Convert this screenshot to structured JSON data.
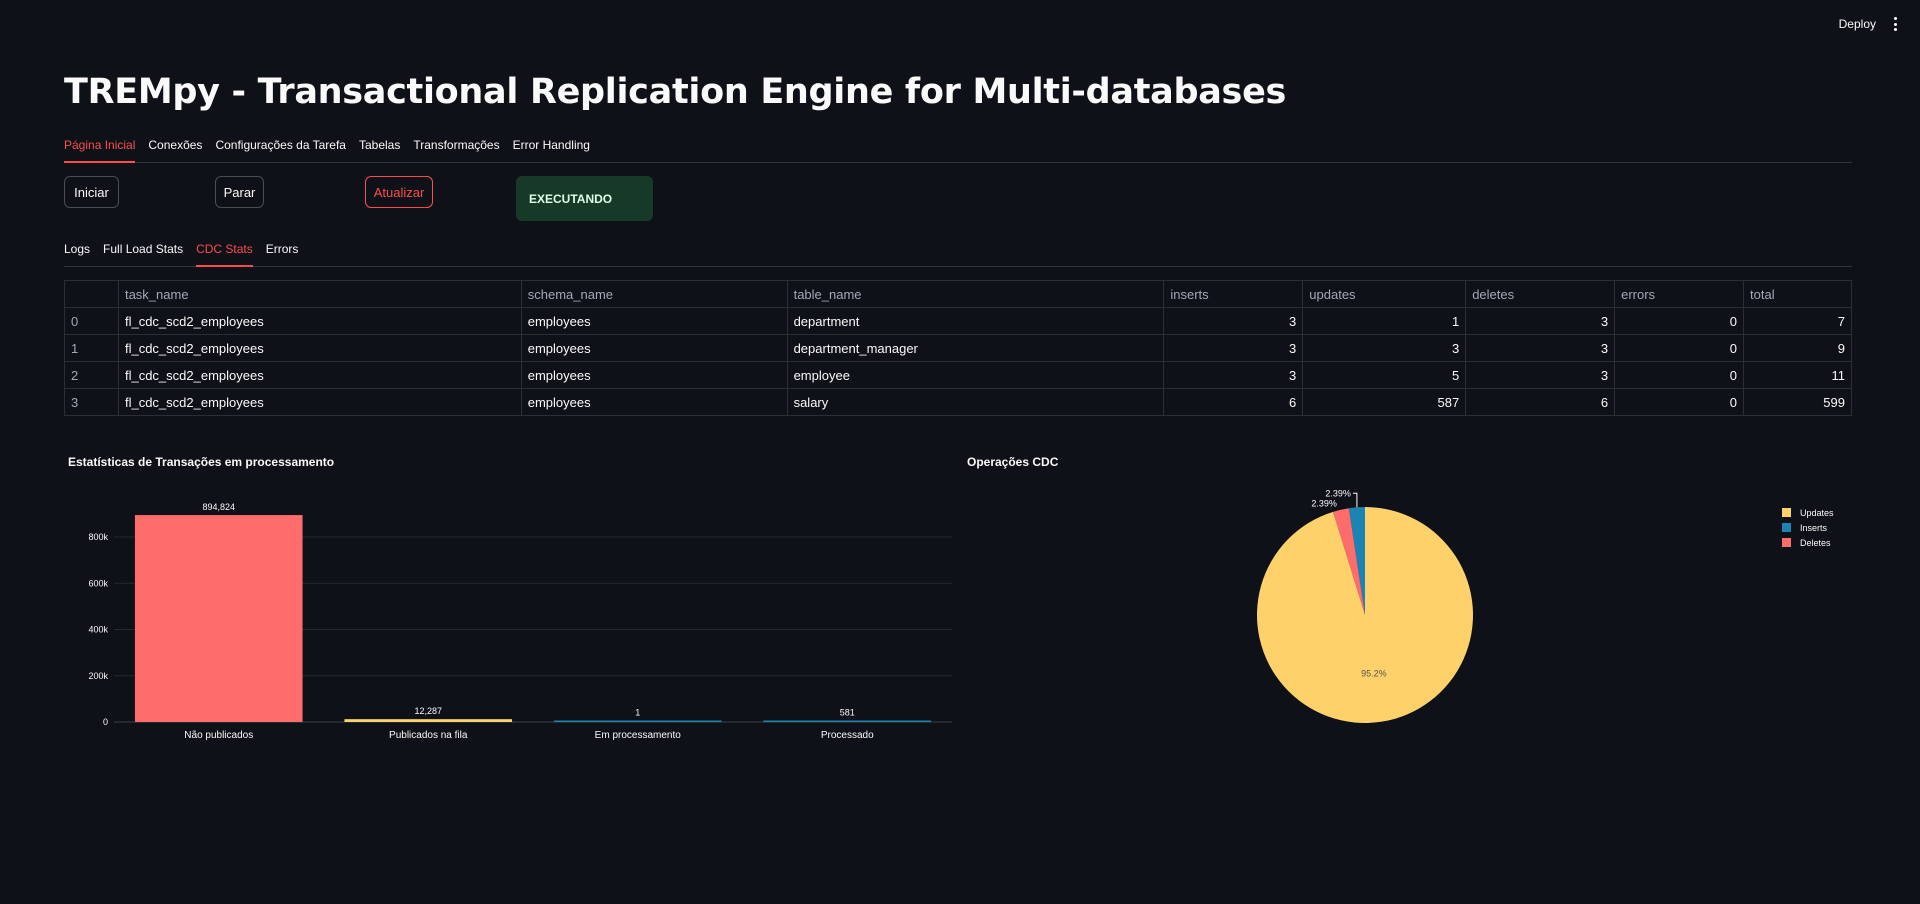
{
  "topbar": {
    "deploy_label": "Deploy"
  },
  "title": "TREMpy - Transactional Replication Engine for Multi-databases",
  "main_tabs": [
    "Página Inicial",
    "Conexões",
    "Configurações da Tarefa",
    "Tabelas",
    "Transformações",
    "Error Handling"
  ],
  "buttons": {
    "start": "Iniciar",
    "stop": "Parar",
    "refresh": "Atualizar"
  },
  "status": "EXECUTANDO",
  "sub_tabs": [
    "Logs",
    "Full Load Stats",
    "CDC Stats",
    "Errors"
  ],
  "table": {
    "columns": [
      "",
      "task_name",
      "schema_name",
      "table_name",
      "inserts",
      "updates",
      "deletes",
      "errors",
      "total"
    ],
    "rows": [
      [
        "0",
        "fl_cdc_scd2_employees",
        "employees",
        "department",
        "3",
        "1",
        "3",
        "0",
        "7"
      ],
      [
        "1",
        "fl_cdc_scd2_employees",
        "employees",
        "department_manager",
        "3",
        "3",
        "3",
        "0",
        "9"
      ],
      [
        "2",
        "fl_cdc_scd2_employees",
        "employees",
        "employee",
        "3",
        "5",
        "3",
        "0",
        "11"
      ],
      [
        "3",
        "fl_cdc_scd2_employees",
        "employees",
        "salary",
        "6",
        "587",
        "6",
        "0",
        "599"
      ]
    ]
  },
  "colors": {
    "accent": "#ff4b4b",
    "updates": "#ffd16a",
    "inserts": "#1c83b5",
    "deletes": "#ff6c6c"
  },
  "chart_data": [
    {
      "type": "bar",
      "title": "Estatísticas de Transações em processamento",
      "categories": [
        "Não publicados",
        "Publicados na fila",
        "Em processamento",
        "Processado"
      ],
      "values": [
        894824,
        12287,
        1,
        581
      ],
      "data_labels": [
        "894,824",
        "12,287",
        "1",
        "581"
      ],
      "colors": [
        "#ff6c6c",
        "#ffd16a",
        "#1c83b5",
        "#1c83b5"
      ],
      "ylim": [
        0,
        960000
      ],
      "yticks": [
        0,
        200000,
        400000,
        600000,
        800000
      ],
      "ytick_labels": [
        "0",
        "200k",
        "400k",
        "600k",
        "800k"
      ],
      "grid": true
    },
    {
      "type": "pie",
      "title": "Operações CDC",
      "labels": [
        "Updates",
        "Inserts",
        "Deletes"
      ],
      "values": [
        95.2,
        2.39,
        2.39
      ],
      "data_labels": [
        "95.2%",
        "2.39%",
        "2.39%"
      ],
      "colors": [
        "#ffd16a",
        "#1c83b5",
        "#ff6c6c"
      ],
      "legend": "right"
    }
  ]
}
